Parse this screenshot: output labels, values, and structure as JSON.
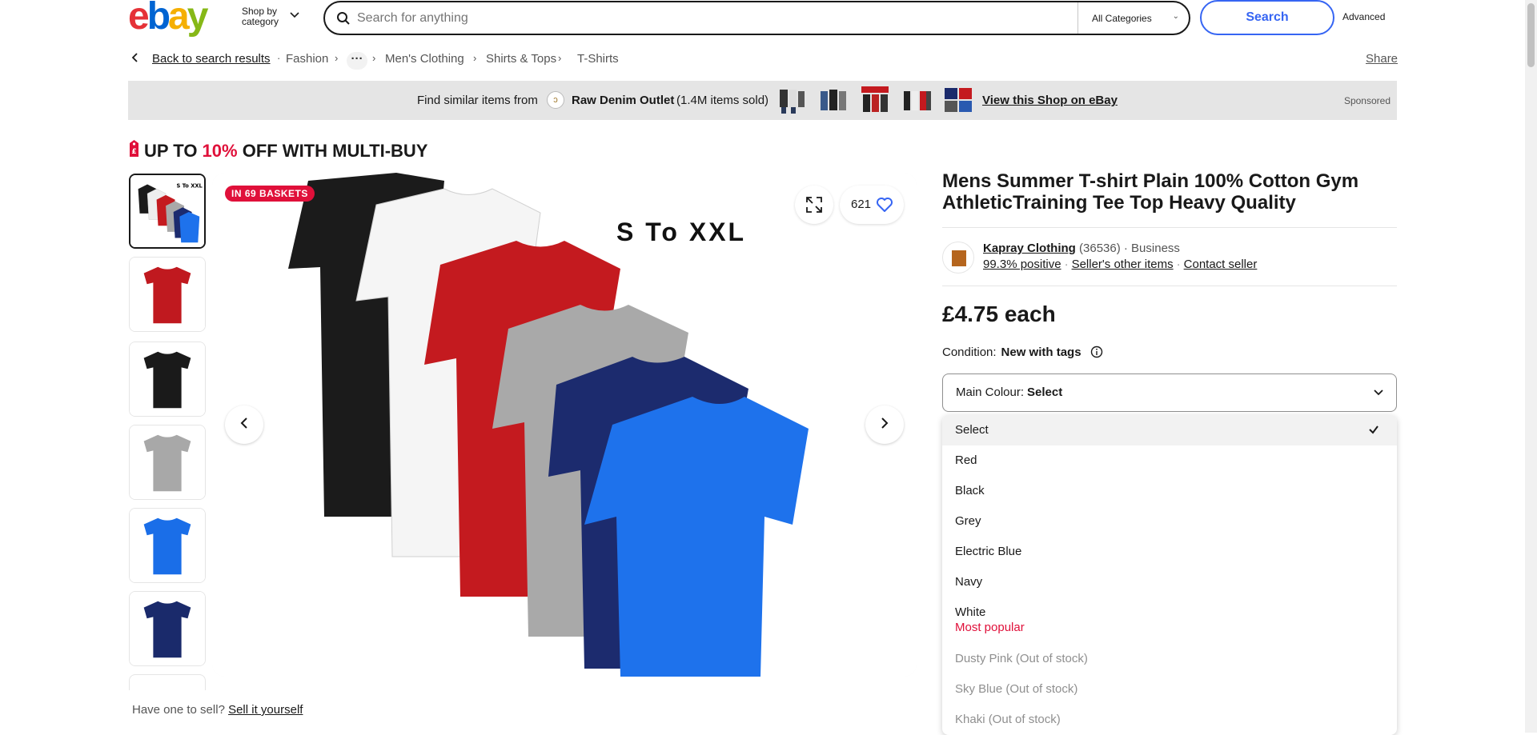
{
  "header": {
    "logo_letters": [
      "e",
      "b",
      "a",
      "y"
    ],
    "shop_by_category": [
      "Shop by",
      "category"
    ],
    "search_placeholder": "Search for anything",
    "category_select": "All Categories",
    "search_button": "Search",
    "advanced": "Advanced"
  },
  "breadcrumb": {
    "back": "Back to search results",
    "items": [
      "Fashion",
      "Men's Clothing",
      "Shirts & Tops",
      "T-Shirts"
    ],
    "share": "Share"
  },
  "banner": {
    "find_similar": "Find similar items from",
    "shop_name": "Raw Denim Outlet",
    "items_sold": "(1.4M items sold)",
    "view_shop": "View this Shop on eBay",
    "sponsored": "Sponsored"
  },
  "multibuy": {
    "prefix": "UP TO ",
    "percent": "10%",
    "suffix": " OFF WITH MULTI-BUY"
  },
  "gallery": {
    "badge": "IN 69 BASKETS",
    "watch_count": "621",
    "size_text": "S To XXL",
    "thumbnail_colors": [
      "#c0191f",
      "#1a1a1a",
      "#a8a8a8",
      "#1a6ee8",
      "#1a2a6b"
    ],
    "image_shirt_colors": [
      "#1b1b1b",
      "#f5f5f5",
      "#c41a1f",
      "#a9a9a9",
      "#1c2b6e",
      "#1e72ec"
    ]
  },
  "sell_line": {
    "text": "Have one to sell?",
    "link": "Sell it yourself"
  },
  "product": {
    "title": "Mens Summer T-shirt Plain 100% Cotton Gym AthleticTraining Tee Top Heavy Quality",
    "seller_name": "Kapray Clothing",
    "seller_feedback": "(36536)",
    "seller_type": "· Business",
    "positive": "99.3% positive",
    "other_items": "Seller's other items",
    "contact": "Contact seller",
    "price": "£4.75 each",
    "condition_label": "Condition:",
    "condition_value": "New with tags"
  },
  "colour_select": {
    "label": "Main Colour:",
    "value": "Select",
    "options": [
      {
        "label": "Select",
        "selected": true
      },
      {
        "label": "Red"
      },
      {
        "label": "Black"
      },
      {
        "label": "Grey"
      },
      {
        "label": "Electric Blue"
      },
      {
        "label": "Navy"
      },
      {
        "label": "White",
        "note": "Most popular"
      },
      {
        "label": "Dusty Pink (Out of stock)",
        "oos": true
      },
      {
        "label": "Sky Blue (Out of stock)",
        "oos": true
      },
      {
        "label": "Khaki (Out of stock)",
        "oos": true
      }
    ]
  }
}
